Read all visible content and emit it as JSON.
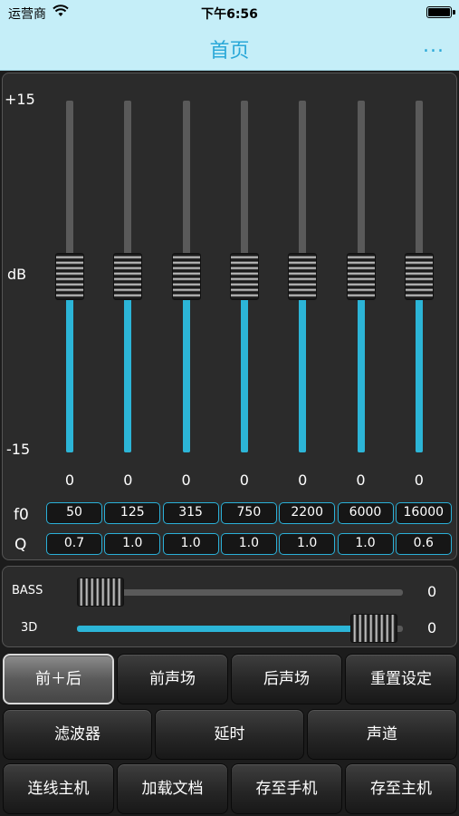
{
  "status": {
    "carrier": "运营商",
    "time": "下午6:56"
  },
  "nav": {
    "title": "首页",
    "more": "..."
  },
  "eq": {
    "scale_top": "+15",
    "scale_mid": "dB",
    "scale_bottom": "-15",
    "f0_label": "f0",
    "q_label": "Q",
    "bands": [
      {
        "gain": "0",
        "f0": "50",
        "q": "0.7"
      },
      {
        "gain": "0",
        "f0": "125",
        "q": "1.0"
      },
      {
        "gain": "0",
        "f0": "315",
        "q": "1.0"
      },
      {
        "gain": "0",
        "f0": "750",
        "q": "1.0"
      },
      {
        "gain": "0",
        "f0": "2200",
        "q": "1.0"
      },
      {
        "gain": "0",
        "f0": "6000",
        "q": "1.0"
      },
      {
        "gain": "0",
        "f0": "16000",
        "q": "0.6"
      }
    ]
  },
  "bass": {
    "label": "BASS",
    "value": "0",
    "level": 0
  },
  "threed": {
    "label": "3D",
    "value": "0",
    "level": 1
  },
  "buttons": {
    "front_rear": "前＋后",
    "front_stage": "前声场",
    "rear_stage": "后声场",
    "reset": "重置设定",
    "filter": "滤波器",
    "delay": "延时",
    "channel": "声道",
    "connect": "连线主机",
    "load": "加载文档",
    "save_phone": "存至手机",
    "save_host": "存至主机"
  },
  "colors": {
    "accent": "#2cb5d7",
    "nav_bg": "#c5eef8",
    "title": "#2aa8d8"
  }
}
